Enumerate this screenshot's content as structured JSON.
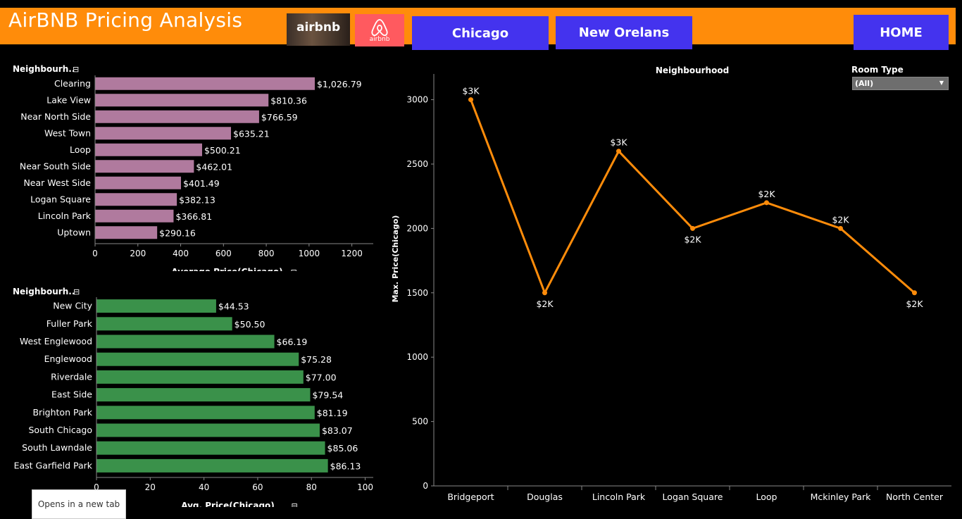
{
  "header": {
    "title": "AirBNB Pricing Analysis",
    "logo1_text": "airbnb",
    "logo2_text": "airbnb"
  },
  "nav": {
    "chicago": "Chicago",
    "new_orleans": "New Orelans",
    "home": "HOME"
  },
  "tooltip": "Opens in a new tab",
  "room_type": {
    "label": "Room Type",
    "value": "(All)"
  },
  "colors": {
    "header": "#ff8c0a",
    "nav": "#4433ee",
    "top_bars": "#b07a9e",
    "bottom_bars": "#3a914a",
    "line": "#ff8c0a"
  },
  "chart_data": [
    {
      "type": "bar",
      "title": "",
      "ylabel": "Neighbourh..",
      "xlabel": "Average Price(Chicago)",
      "categories": [
        "Clearing",
        "Lake View",
        "Near North Side",
        "West Town",
        "Loop",
        "Near South Side",
        "Near West Side",
        "Logan Square",
        "Lincoln Park",
        "Uptown"
      ],
      "values": [
        1026.79,
        810.36,
        766.59,
        635.21,
        500.21,
        462.01,
        401.49,
        382.13,
        366.81,
        290.16
      ],
      "labels": [
        "$1,026.79",
        "$810.36",
        "$766.59",
        "$635.21",
        "$500.21",
        "$462.01",
        "$401.49",
        "$382.13",
        "$366.81",
        "$290.16"
      ],
      "ticks": [
        "0",
        "200",
        "400",
        "600",
        "800",
        "1000",
        "1200"
      ],
      "xlim": [
        0,
        1300
      ]
    },
    {
      "type": "bar",
      "title": "",
      "ylabel": "Neighbourh..",
      "xlabel": "Avg. Price(Chicago)",
      "categories": [
        "New City",
        "Fuller Park",
        "West Englewood",
        "Englewood",
        "Riverdale",
        "East Side",
        "Brighton Park",
        "South Chicago",
        "South Lawndale",
        "East Garfield Park"
      ],
      "values": [
        44.53,
        50.5,
        66.19,
        75.28,
        77.0,
        79.54,
        81.19,
        83.07,
        85.06,
        86.13
      ],
      "labels": [
        "$44.53",
        "$50.50",
        "$66.19",
        "$75.28",
        "$77.00",
        "$79.54",
        "$81.19",
        "$83.07",
        "$85.06",
        "$86.13"
      ],
      "ticks": [
        "0",
        "20",
        "40",
        "60",
        "80",
        "100"
      ],
      "xlim": [
        0,
        103
      ]
    },
    {
      "type": "line",
      "title": "Neighbourhood",
      "ylabel": "Max. Price(Chicago)",
      "xlabel": "",
      "categories": [
        "Bridgeport",
        "Douglas",
        "Lincoln Park",
        "Logan Square",
        "Loop",
        "Mckinley Park",
        "North Center"
      ],
      "values": [
        3000,
        1500,
        2600,
        2000,
        2200,
        2000,
        1500
      ],
      "labels": [
        "$3K",
        "$2K",
        "$3K",
        "$2K",
        "$2K",
        "$2K",
        "$2K"
      ],
      "ticks": [
        "0",
        "500",
        "1000",
        "1500",
        "2000",
        "2500",
        "3000"
      ],
      "ylim": [
        0,
        3200
      ]
    }
  ]
}
